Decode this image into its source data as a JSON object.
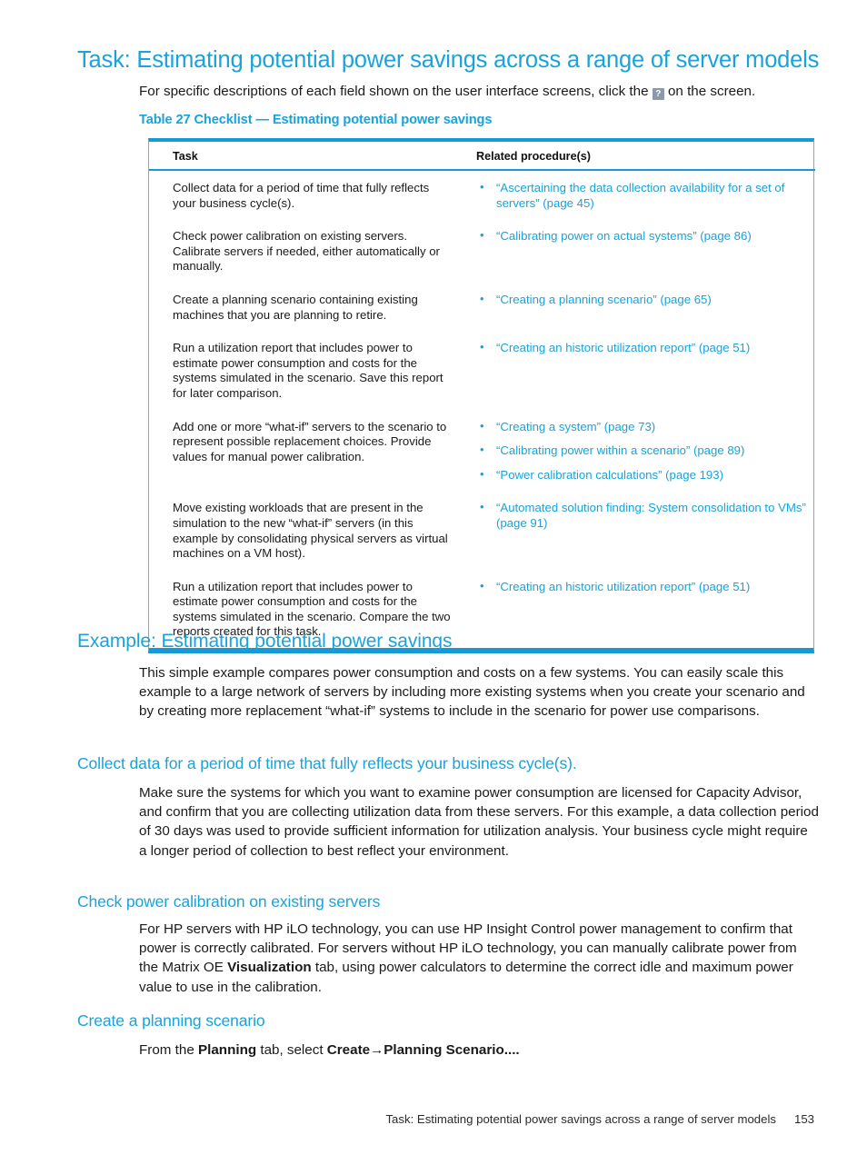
{
  "page": {
    "title": "Task: Estimating potential power savings across a range of server models",
    "intro_before_icon": "For specific descriptions of each field shown on the user interface screens, click the ",
    "help_icon_glyph": "?",
    "intro_after_icon": " on the screen.",
    "accent_color": "#18A3DC",
    "table_border_color": "#1799D6",
    "body_text_color": "#1a1a1a"
  },
  "table": {
    "caption": "Table 27 Checklist — Estimating potential power savings",
    "headers": {
      "task": "Task",
      "related": "Related procedure(s)"
    },
    "rows": [
      {
        "task": "Collect data for a period of time that fully reflects your business cycle(s).",
        "procedures": [
          "“Ascertaining the data collection availability for a set of servers” (page 45)"
        ]
      },
      {
        "task": "Check power calibration on existing servers. Calibrate servers if needed, either automatically or manually.",
        "procedures": [
          "“Calibrating power on actual systems” (page 86)"
        ]
      },
      {
        "task": "Create a planning scenario containing existing machines that you are planning to retire.",
        "procedures": [
          "“Creating a planning scenario” (page 65)"
        ]
      },
      {
        "task": "Run a utilization report that includes power to estimate power consumption and costs for the systems simulated in the scenario. Save this report for later comparison.",
        "procedures": [
          "“Creating an historic utilization report” (page 51)"
        ]
      },
      {
        "task": "Add one or more “what-if” servers to the scenario to represent possible replacement choices. Provide values for manual power calibration.",
        "procedures": [
          "“Creating a system” (page 73)",
          "“Calibrating power within a scenario” (page 89)",
          "“Power calibration calculations” (page 193)"
        ]
      },
      {
        "task": "Move existing workloads that are present in the simulation to the new “what-if” servers (in this example by consolidating physical servers as virtual machines on a VM host).",
        "procedures": [
          "“Automated solution finding: System consolidation to VMs” (page 91)"
        ]
      },
      {
        "task": "Run a utilization report that includes power to estimate power consumption and costs for the systems simulated in the scenario. Compare the two reports created for this task.",
        "procedures": [
          "“Creating an historic utilization report” (page 51)"
        ]
      }
    ]
  },
  "sections": {
    "example": {
      "heading": "Example: Estimating potential power savings",
      "paragraph": "This simple example compares power consumption and costs on a few systems. You can easily scale this example to a large network of servers by including more existing systems when you create your scenario and by creating more replacement “what-if” systems to include in the scenario for power use comparisons."
    },
    "collect_data": {
      "heading": "Collect data for a period of time that fully reflects your business cycle(s).",
      "paragraph": "Make sure the systems for which you want to examine power consumption are licensed for Capacity Advisor, and confirm that you are collecting utilization data from these servers. For this example, a data collection period of 30 days was used to provide sufficient information for utilization analysis. Your business cycle might require a longer period of collection to best reflect your environment."
    },
    "check_power": {
      "heading": "Check power calibration on existing servers",
      "para_part1": "For HP servers with HP iLO technology, you can use HP Insight Control power management to confirm that power is correctly calibrated. For servers without HP iLO technology, you can manually calibrate power from the Matrix OE ",
      "para_bold": "Visualization",
      "para_part2": " tab, using power calculators to determine the correct idle and maximum power value to use in the calibration."
    },
    "create_scenario": {
      "heading": "Create a planning scenario",
      "para_part1": "From the ",
      "para_bold1": "Planning",
      "para_part2": " tab, select ",
      "para_bold2": "Create→Planning Scenario....",
      "para_part3": ""
    }
  },
  "footer": {
    "running_title": "Task: Estimating potential power savings across a range of server models",
    "page_number": "153"
  }
}
